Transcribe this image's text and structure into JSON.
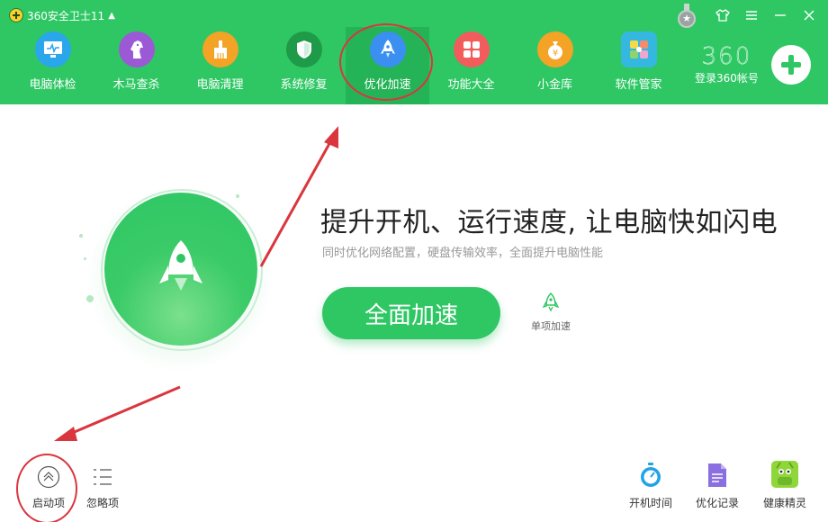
{
  "app": {
    "title": "360安全卫士11"
  },
  "nav": {
    "items": [
      {
        "label": "电脑体检",
        "icon": "monitor-checkup-icon",
        "color": "#2aa6ea"
      },
      {
        "label": "木马查杀",
        "icon": "horse-icon",
        "color": "#9b59d6"
      },
      {
        "label": "电脑清理",
        "icon": "broom-icon",
        "color": "#f3a325"
      },
      {
        "label": "系统修复",
        "icon": "shield-icon",
        "color": "#1e9a48"
      },
      {
        "label": "优化加速",
        "icon": "rocket-icon",
        "color": "#3b8ff0"
      },
      {
        "label": "功能大全",
        "icon": "grid-icon",
        "color": "#f25c5c"
      },
      {
        "label": "小金库",
        "icon": "money-bag-icon",
        "color": "#f3a325"
      },
      {
        "label": "软件管家",
        "icon": "software-manager-icon",
        "color": "#35b8e0"
      }
    ],
    "active_index": 4
  },
  "account": {
    "logo": "360",
    "label": "登录360帐号"
  },
  "main": {
    "headline": "提升开机、运行速度, 让电脑快如闪电",
    "subline": "同时优化网络配置，硬盘传输效率，全面提升电脑性能",
    "primary_button": "全面加速",
    "single_label": "单项加速"
  },
  "bottom": {
    "left": [
      {
        "label": "启动项",
        "icon": "chevron-up-circle-icon"
      },
      {
        "label": "忽略项",
        "icon": "list-icon"
      }
    ],
    "right": [
      {
        "label": "开机时间",
        "icon": "stopwatch-icon"
      },
      {
        "label": "优化记录",
        "icon": "document-icon"
      },
      {
        "label": "健康精灵",
        "icon": "android-sprite-icon"
      }
    ]
  },
  "colors": {
    "brand_green": "#2ec764",
    "annotation_red": "#d9363e"
  }
}
